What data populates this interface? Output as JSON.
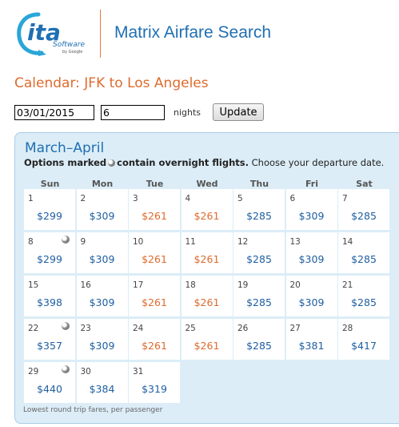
{
  "logo": {
    "text": "ita",
    "sub": "Software",
    "by": "by Google"
  },
  "header": {
    "title": "Matrix Airfare Search"
  },
  "calendar_heading": "Calendar: JFK to Los Angeles",
  "form": {
    "date_value": "03/01/2015",
    "nights_value": "6",
    "nights_label": "nights",
    "update_label": "Update"
  },
  "calendar": {
    "month_title": "March–April",
    "options_bold1": "Options marked",
    "options_bold2": "contain overnight flights.",
    "options_rest": " Choose your departure date.",
    "days_of_week": [
      "Sun",
      "Mon",
      "Tue",
      "Wed",
      "Thu",
      "Fri",
      "Sat"
    ],
    "days": [
      {
        "day": "1",
        "price": "$299",
        "color": "blue",
        "overnight": false
      },
      {
        "day": "2",
        "price": "$309",
        "color": "blue",
        "overnight": false
      },
      {
        "day": "3",
        "price": "$261",
        "color": "orange",
        "overnight": false
      },
      {
        "day": "4",
        "price": "$261",
        "color": "orange",
        "overnight": false
      },
      {
        "day": "5",
        "price": "$285",
        "color": "blue",
        "overnight": false
      },
      {
        "day": "6",
        "price": "$309",
        "color": "blue",
        "overnight": false
      },
      {
        "day": "7",
        "price": "$285",
        "color": "blue",
        "overnight": false
      },
      {
        "day": "8",
        "price": "$299",
        "color": "blue",
        "overnight": true
      },
      {
        "day": "9",
        "price": "$309",
        "color": "blue",
        "overnight": false
      },
      {
        "day": "10",
        "price": "$261",
        "color": "orange",
        "overnight": false
      },
      {
        "day": "11",
        "price": "$261",
        "color": "orange",
        "overnight": false
      },
      {
        "day": "12",
        "price": "$285",
        "color": "blue",
        "overnight": false
      },
      {
        "day": "13",
        "price": "$309",
        "color": "blue",
        "overnight": false
      },
      {
        "day": "14",
        "price": "$285",
        "color": "blue",
        "overnight": false
      },
      {
        "day": "15",
        "price": "$398",
        "color": "blue",
        "overnight": false
      },
      {
        "day": "16",
        "price": "$309",
        "color": "blue",
        "overnight": false
      },
      {
        "day": "17",
        "price": "$261",
        "color": "orange",
        "overnight": false
      },
      {
        "day": "18",
        "price": "$261",
        "color": "orange",
        "overnight": false
      },
      {
        "day": "19",
        "price": "$285",
        "color": "blue",
        "overnight": false
      },
      {
        "day": "20",
        "price": "$309",
        "color": "blue",
        "overnight": false
      },
      {
        "day": "21",
        "price": "$285",
        "color": "blue",
        "overnight": false
      },
      {
        "day": "22",
        "price": "$357",
        "color": "blue",
        "overnight": true
      },
      {
        "day": "23",
        "price": "$309",
        "color": "blue",
        "overnight": false
      },
      {
        "day": "24",
        "price": "$261",
        "color": "orange",
        "overnight": false
      },
      {
        "day": "25",
        "price": "$261",
        "color": "orange",
        "overnight": false
      },
      {
        "day": "26",
        "price": "$285",
        "color": "blue",
        "overnight": false
      },
      {
        "day": "27",
        "price": "$381",
        "color": "blue",
        "overnight": false
      },
      {
        "day": "28",
        "price": "$417",
        "color": "blue",
        "overnight": false
      },
      {
        "day": "29",
        "price": "$440",
        "color": "blue",
        "overnight": true
      },
      {
        "day": "30",
        "price": "$384",
        "color": "blue",
        "overnight": false
      },
      {
        "day": "31",
        "price": "$319",
        "color": "blue",
        "overnight": false
      }
    ],
    "footer_note": "Lowest round trip fares, per passenger"
  },
  "colors": {
    "blue": "#1f5fa0",
    "orange": "#de6b2d",
    "panel": "#dcedf7"
  },
  "icons": {
    "overnight": "moon-icon"
  }
}
